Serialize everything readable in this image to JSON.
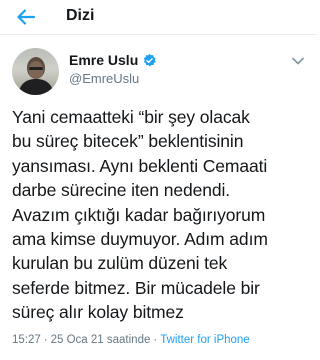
{
  "header": {
    "title": "Dizi"
  },
  "tweet": {
    "display_name": "Emre Uslu",
    "handle": "@EmreUslu",
    "text": "Yani cemaatteki “bir şey olacak\nbu süreç bitecek” beklentisinin\nyansıması. Aynı beklenti Cemaati\ndarbe sürecine iten nedendi.\nAvazım çıktığı kadar bağırıyorum\nama kimse duymuyor. Adım adım\nkurulan bu zulüm düzeni tek\nseferde bitmez. Bir mücadele bir\nsüreç alır kolay bitmez",
    "time": "15:27",
    "date": "25 Oca 21 saatinde",
    "dot": "·",
    "source": "Twitter for iPhone"
  },
  "colors": {
    "accent": "#1da1f2",
    "text": "#14171a",
    "secondary": "#657786"
  },
  "icons": {
    "back": "back-arrow-icon",
    "verified": "verified-badge-icon",
    "more": "chevron-down-icon"
  }
}
